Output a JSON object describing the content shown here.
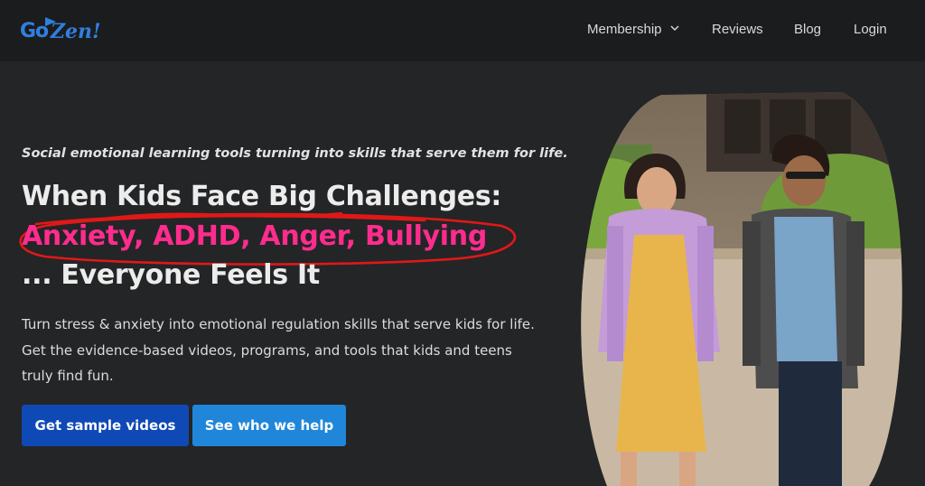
{
  "header": {
    "logo": {
      "go": "Go",
      "zen": "Zen!"
    },
    "nav": {
      "membership": "Membership",
      "reviews": "Reviews",
      "blog": "Blog",
      "login": "Login"
    }
  },
  "hero": {
    "tagline": "Social emotional learning tools turning into skills that serve them for life.",
    "headline_line1": "When Kids Face Big Challenges:",
    "headline_line2": "Anxiety, ADHD, Anger, Bullying",
    "headline_line3": "... Everyone Feels It",
    "body_line1": "Turn stress & anxiety into emotional regulation skills that serve kids for life.",
    "body_line2": "Get the evidence-based videos, programs, and tools that kids and teens",
    "body_line3": "truly find fun.",
    "primary_button": "Get sample videos",
    "secondary_button": "See who we help"
  },
  "colors": {
    "accent_pink": "#ff2c8e",
    "primary_blue": "#0f49b5",
    "secondary_blue": "#1f86d9",
    "logo_blue": "#2f7fe0",
    "scribble_red": "#e01818"
  },
  "icons": {
    "logo": "gozen-logo",
    "membership_dropdown": "chevron-down-icon"
  }
}
